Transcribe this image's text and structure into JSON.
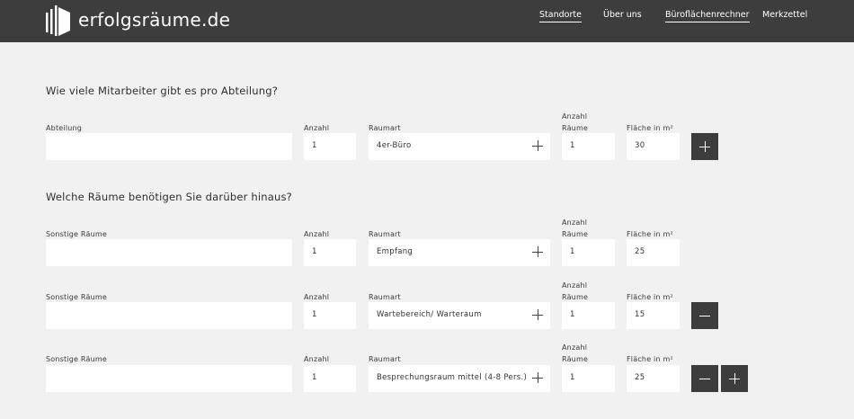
{
  "header": {
    "logo_text": "erfolgsräume.de",
    "nav": [
      {
        "label": "Standorte"
      },
      {
        "label": "Über uns"
      },
      {
        "label": "Büroflächenrechner"
      },
      {
        "label": "Merkzettel"
      }
    ]
  },
  "section1": {
    "title": "Wie viele Mitarbeiter gibt es pro Abteilung?",
    "labels": {
      "department": "Abteilung",
      "count": "Anzahl",
      "room_type": "Raumart",
      "room_count": "Anzahl Räume",
      "area": "Fläche in m²"
    },
    "row": {
      "department": "",
      "count": "1",
      "room_type": "4er-Büro",
      "room_count": "1",
      "area": "30"
    }
  },
  "section2": {
    "title": "Welche Räume benötigen Sie darüber hinaus?",
    "labels": {
      "other_rooms": "Sonstige Räume",
      "count": "Anzahl",
      "room_type": "Raumart",
      "room_count_1": "Anzahl",
      "room_count_2": "Räume",
      "area": "Fläche in m²"
    },
    "rows": [
      {
        "other": "",
        "count": "1",
        "room_type": "Empfang",
        "room_count": "1",
        "area": "25"
      },
      {
        "other": "",
        "count": "1",
        "room_type": "Wartebereich/ Warteraum",
        "room_count": "1",
        "area": "15"
      },
      {
        "other": "",
        "count": "1",
        "room_type": "Besprechungsraum mittel (4-8 Pers.)",
        "room_count": "1",
        "area": "25"
      }
    ]
  },
  "colors": {
    "header_bg": "#3d3d3d",
    "page_bg": "#f1f1f1",
    "field_bg": "#ffffff",
    "button_bg": "#3d3d3d"
  },
  "icons": {
    "add": "plus-icon",
    "remove": "minus-icon",
    "logo": "logo-icon"
  }
}
